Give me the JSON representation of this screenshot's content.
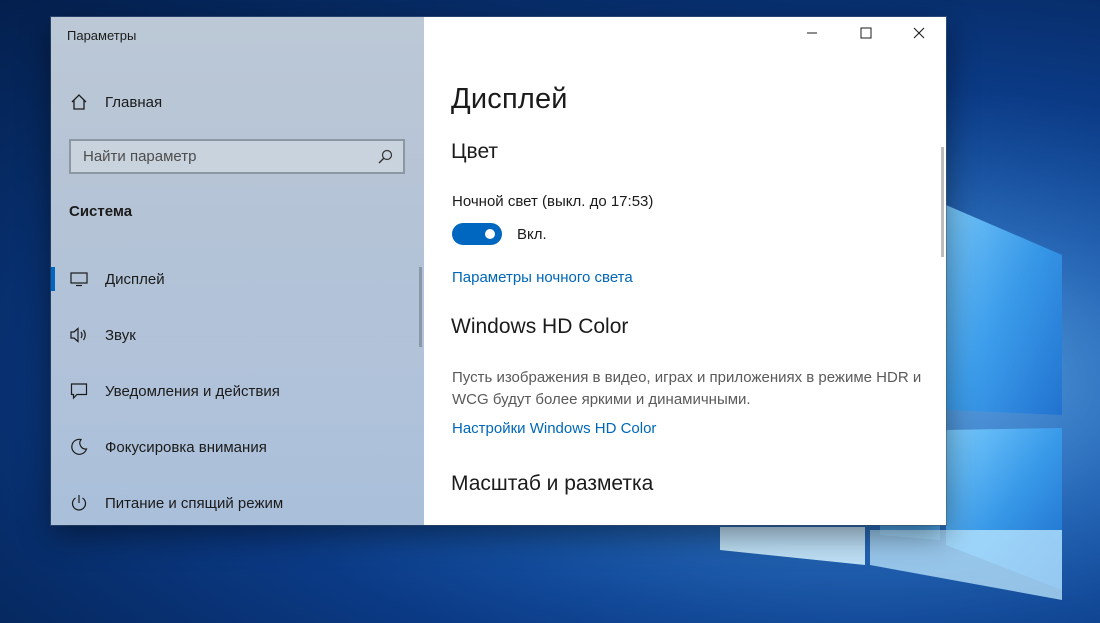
{
  "window": {
    "title": "Параметры",
    "minimize_icon": "minimize-icon",
    "maximize_icon": "maximize-icon",
    "close_icon": "close-icon"
  },
  "sidebar": {
    "home_label": "Главная",
    "home_icon": "home-icon",
    "search": {
      "placeholder": "Найти параметр",
      "value": "",
      "icon": "search-icon"
    },
    "section_label": "Система",
    "items": [
      {
        "label": "Дисплей",
        "icon": "display-icon",
        "selected": true
      },
      {
        "label": "Звук",
        "icon": "speaker-icon",
        "selected": false
      },
      {
        "label": "Уведомления и действия",
        "icon": "notification-icon",
        "selected": false
      },
      {
        "label": "Фокусировка внимания",
        "icon": "moon-icon",
        "selected": false
      },
      {
        "label": "Питание и спящий режим",
        "icon": "power-icon",
        "selected": false
      }
    ]
  },
  "main": {
    "title": "Дисплей",
    "color_heading": "Цвет",
    "night_light_label": "Ночной свет (выкл. до 17:53)",
    "toggle_state": "Вкл.",
    "night_light_link": "Параметры ночного света",
    "hd_heading": "Windows HD Color",
    "hd_description": "Пусть изображения в видео, играх и приложениях в режиме HDR и WCG будут более яркими и динамичными.",
    "hd_link": "Настройки Windows HD Color",
    "scale_heading": "Масштаб и разметка"
  },
  "colors": {
    "accent": "#0067c0",
    "link": "#0067b8",
    "desktop_blue": "#0b3a85"
  }
}
